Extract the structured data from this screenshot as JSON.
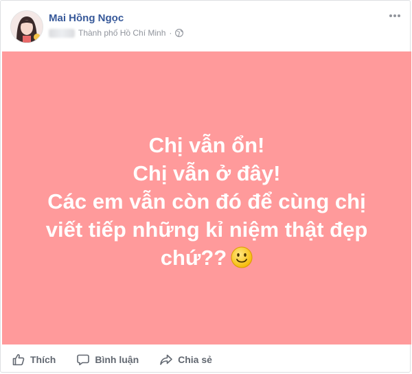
{
  "post": {
    "author": "Mai Hồng Ngọc",
    "location": "Thành phố Hồ Chí Minh",
    "separator": "·",
    "lines": [
      "Chị vẫn ổn!",
      "Chị vẫn ở đây!",
      "Các em vẫn còn đó để cùng chị",
      "viết tiếp những kỉ niệm thật đẹp",
      "chứ??"
    ],
    "background_color": "#ff9a9b"
  },
  "actions": {
    "like_label": "Thích",
    "comment_label": "Bình luận",
    "share_label": "Chia sẻ"
  },
  "icons": {
    "avatar": "avatar",
    "more": "more-options-icon",
    "audience": "globe-icon",
    "like": "thumbs-up-icon",
    "comment": "comment-icon",
    "share": "share-icon",
    "emoji": "smiley-icon"
  }
}
